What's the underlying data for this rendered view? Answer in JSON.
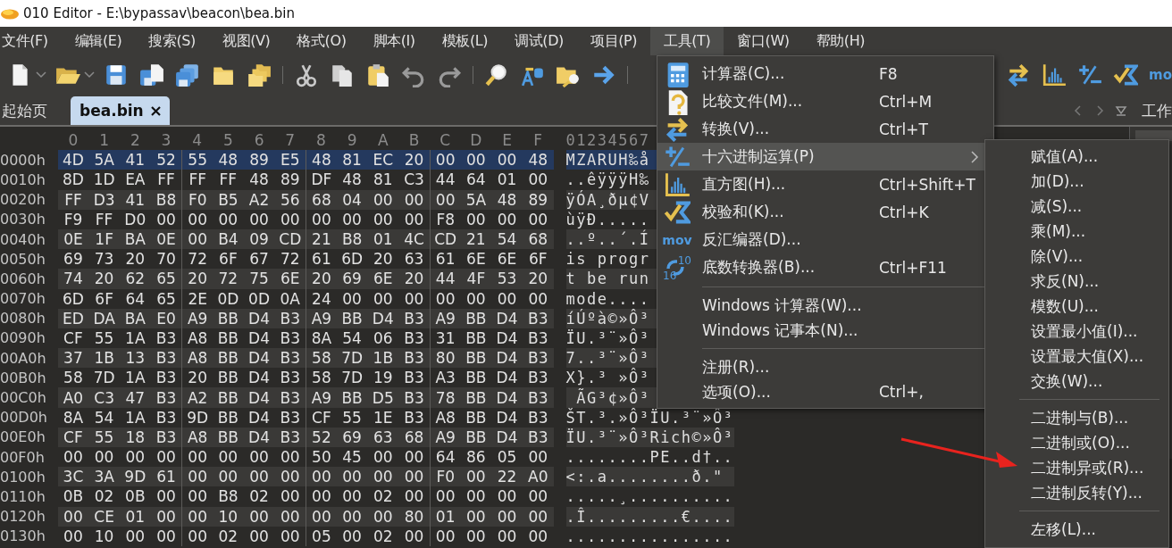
{
  "window": {
    "title": "010 Editor - E:\\bypassav\\beacon\\bea.bin"
  },
  "menu_bar": [
    {
      "label": "文件(F)",
      "selected": false
    },
    {
      "label": "编辑(E)",
      "selected": false
    },
    {
      "label": "搜索(S)",
      "selected": false
    },
    {
      "label": "视图(V)",
      "selected": false
    },
    {
      "label": "格式(O)",
      "selected": false
    },
    {
      "label": "脚本(I)",
      "selected": false
    },
    {
      "label": "模板(L)",
      "selected": false
    },
    {
      "label": "调试(D)",
      "selected": false
    },
    {
      "label": "项目(P)",
      "selected": false
    },
    {
      "label": "工具(T)",
      "selected": true
    },
    {
      "label": "窗口(W)",
      "selected": false
    },
    {
      "label": "帮助(H)",
      "selected": false
    }
  ],
  "toolbar": {
    "cut_label": "mo"
  },
  "tabs": [
    {
      "label": "起始页",
      "selected": false,
      "closable": false
    },
    {
      "label": "bea.bin",
      "selected": true,
      "closable": true
    }
  ],
  "workspace_tab": "工作",
  "hex_view": {
    "column_headers": [
      "0",
      "1",
      "2",
      "3",
      "4",
      "5",
      "6",
      "7",
      "8",
      "9",
      "A",
      "B",
      "C",
      "D",
      "E",
      "F"
    ],
    "ascii_header": "01234567",
    "rows": [
      {
        "offset": "0000h",
        "selected": true,
        "bytes": [
          "4D",
          "5A",
          "41",
          "52",
          "55",
          "48",
          "89",
          "E5",
          "48",
          "81",
          "EC",
          "20",
          "00",
          "00",
          "00",
          "48"
        ],
        "ascii": "MZARUH‰å"
      },
      {
        "offset": "0010h",
        "selected": false,
        "bytes": [
          "8D",
          "1D",
          "EA",
          "FF",
          "FF",
          "FF",
          "48",
          "89",
          "DF",
          "48",
          "81",
          "C3",
          "44",
          "64",
          "01",
          "00"
        ],
        "ascii": "..êÿÿÿH‰"
      },
      {
        "offset": "0020h",
        "selected": false,
        "bytes": [
          "FF",
          "D3",
          "41",
          "B8",
          "F0",
          "B5",
          "A2",
          "56",
          "68",
          "04",
          "00",
          "00",
          "00",
          "5A",
          "48",
          "89"
        ],
        "ascii": "ÿÓA¸ðµ¢V"
      },
      {
        "offset": "0030h",
        "selected": false,
        "bytes": [
          "F9",
          "FF",
          "D0",
          "00",
          "00",
          "00",
          "00",
          "00",
          "00",
          "00",
          "00",
          "00",
          "F8",
          "00",
          "00",
          "00"
        ],
        "ascii": "ùÿÐ....."
      },
      {
        "offset": "0040h",
        "selected": false,
        "bytes": [
          "0E",
          "1F",
          "BA",
          "0E",
          "00",
          "B4",
          "09",
          "CD",
          "21",
          "B8",
          "01",
          "4C",
          "CD",
          "21",
          "54",
          "68"
        ],
        "ascii": "..º..´.Í"
      },
      {
        "offset": "0050h",
        "selected": false,
        "bytes": [
          "69",
          "73",
          "20",
          "70",
          "72",
          "6F",
          "67",
          "72",
          "61",
          "6D",
          "20",
          "63",
          "61",
          "6E",
          "6E",
          "6F"
        ],
        "ascii": "is progr"
      },
      {
        "offset": "0060h",
        "selected": false,
        "bytes": [
          "74",
          "20",
          "62",
          "65",
          "20",
          "72",
          "75",
          "6E",
          "20",
          "69",
          "6E",
          "20",
          "44",
          "4F",
          "53",
          "20"
        ],
        "ascii": "t be run"
      },
      {
        "offset": "0070h",
        "selected": false,
        "bytes": [
          "6D",
          "6F",
          "64",
          "65",
          "2E",
          "0D",
          "0D",
          "0A",
          "24",
          "00",
          "00",
          "00",
          "00",
          "00",
          "00",
          "00"
        ],
        "ascii": "mode...."
      },
      {
        "offset": "0080h",
        "selected": false,
        "bytes": [
          "ED",
          "DA",
          "BA",
          "E0",
          "A9",
          "BB",
          "D4",
          "B3",
          "A9",
          "BB",
          "D4",
          "B3",
          "A9",
          "BB",
          "D4",
          "B3"
        ],
        "ascii": "íÚºà©»Ô³"
      },
      {
        "offset": "0090h",
        "selected": false,
        "bytes": [
          "CF",
          "55",
          "1A",
          "B3",
          "A8",
          "BB",
          "D4",
          "B3",
          "8A",
          "54",
          "06",
          "B3",
          "31",
          "BB",
          "D4",
          "B3"
        ],
        "ascii": "ÏU.³¨»Ô³"
      },
      {
        "offset": "00A0h",
        "selected": false,
        "bytes": [
          "37",
          "1B",
          "13",
          "B3",
          "A8",
          "BB",
          "D4",
          "B3",
          "58",
          "7D",
          "1B",
          "B3",
          "80",
          "BB",
          "D4",
          "B3"
        ],
        "ascii": "7..³¨»Ô³"
      },
      {
        "offset": "00B0h",
        "selected": false,
        "bytes": [
          "58",
          "7D",
          "1A",
          "B3",
          "20",
          "BB",
          "D4",
          "B3",
          "58",
          "7D",
          "19",
          "B3",
          "A3",
          "BB",
          "D4",
          "B3"
        ],
        "ascii": "X}.³ »Ô³"
      },
      {
        "offset": "00C0h",
        "selected": false,
        "bytes": [
          "A0",
          "C3",
          "47",
          "B3",
          "A2",
          "BB",
          "D4",
          "B3",
          "A9",
          "BB",
          "D5",
          "B3",
          "78",
          "BB",
          "D4",
          "B3"
        ],
        "ascii": " ÃG³¢»Ô³"
      },
      {
        "offset": "00D0h",
        "selected": false,
        "bytes": [
          "8A",
          "54",
          "1A",
          "B3",
          "9D",
          "BB",
          "D4",
          "B3",
          "CF",
          "55",
          "1E",
          "B3",
          "A8",
          "BB",
          "D4",
          "B3"
        ],
        "ascii": "ŠT.³.»Ô³ÏU.³¨»Ô³"
      },
      {
        "offset": "00E0h",
        "selected": false,
        "bytes": [
          "CF",
          "55",
          "18",
          "B3",
          "A8",
          "BB",
          "D4",
          "B3",
          "52",
          "69",
          "63",
          "68",
          "A9",
          "BB",
          "D4",
          "B3"
        ],
        "ascii": "ÏU.³¨»Ô³Rich©»Ô³"
      },
      {
        "offset": "00F0h",
        "selected": false,
        "bytes": [
          "00",
          "00",
          "00",
          "00",
          "00",
          "00",
          "00",
          "00",
          "50",
          "45",
          "00",
          "00",
          "64",
          "86",
          "05",
          "00"
        ],
        "ascii": "........PE..d†.."
      },
      {
        "offset": "0100h",
        "selected": false,
        "bytes": [
          "3C",
          "3A",
          "9D",
          "61",
          "00",
          "00",
          "00",
          "00",
          "00",
          "00",
          "00",
          "00",
          "F0",
          "00",
          "22",
          "A0"
        ],
        "ascii": "<:.a........ð.\""
      },
      {
        "offset": "0110h",
        "selected": false,
        "bytes": [
          "0B",
          "02",
          "0B",
          "00",
          "00",
          "B8",
          "02",
          "00",
          "00",
          "00",
          "02",
          "00",
          "00",
          "00",
          "00",
          "00"
        ],
        "ascii": ".....¸.........."
      },
      {
        "offset": "0120h",
        "selected": false,
        "bytes": [
          "00",
          "CE",
          "01",
          "00",
          "00",
          "10",
          "00",
          "00",
          "00",
          "00",
          "00",
          "80",
          "01",
          "00",
          "00",
          "00"
        ],
        "ascii": ".Î.........€...."
      },
      {
        "offset": "0130h",
        "selected": false,
        "bytes": [
          "00",
          "10",
          "00",
          "00",
          "00",
          "02",
          "00",
          "00",
          "05",
          "00",
          "02",
          "00",
          "00",
          "00",
          "00",
          "00"
        ],
        "ascii": "................"
      }
    ]
  },
  "tools_menu": {
    "groups": [
      [
        {
          "label": "计算器(C)...",
          "shortcut": "F8",
          "selected": false,
          "has_submenu": false
        },
        {
          "label": "比较文件(M)...",
          "shortcut": "Ctrl+M",
          "selected": false,
          "has_submenu": false
        },
        {
          "label": "转换(V)...",
          "shortcut": "Ctrl+T",
          "selected": false,
          "has_submenu": false
        },
        {
          "label": "十六进制运算(P)",
          "selected": true,
          "has_submenu": true
        },
        {
          "label": "直方图(H)...",
          "shortcut": "Ctrl+Shift+T",
          "selected": false,
          "has_submenu": false
        },
        {
          "label": "校验和(K)...",
          "shortcut": "Ctrl+K",
          "selected": false,
          "has_submenu": false
        },
        {
          "label": "反汇编器(D)...",
          "selected": false,
          "has_submenu": false,
          "icon_text": [
            "mov"
          ]
        },
        {
          "label": "底数转换器(B)...",
          "shortcut": "Ctrl+F11",
          "selected": false,
          "has_submenu": false,
          "icon_text": [
            "10",
            "16"
          ]
        }
      ],
      [
        {
          "label": "Windows 计算器(W)...",
          "selected": false,
          "has_submenu": false
        },
        {
          "label": "Windows 记事本(N)...",
          "selected": false,
          "has_submenu": false
        }
      ],
      [
        {
          "label": "注册(R)...",
          "selected": false,
          "has_submenu": false
        },
        {
          "label": "选项(O)...",
          "shortcut": "Ctrl+,",
          "selected": false,
          "has_submenu": false
        }
      ]
    ]
  },
  "hex_operations_submenu": {
    "groups": [
      [
        "赋值(A)...",
        "加(D)...",
        "减(S)...",
        "乘(M)...",
        "除(V)...",
        "求反(N)...",
        "模数(U)...",
        "设置最小值(I)...",
        "设置最大值(X)...",
        "交换(W)..."
      ],
      [
        "二进制与(B)...",
        "二进制或(O)...",
        "二进制异或(R)...",
        "二进制反转(Y)..."
      ],
      [
        "左移(L)..."
      ]
    ]
  }
}
